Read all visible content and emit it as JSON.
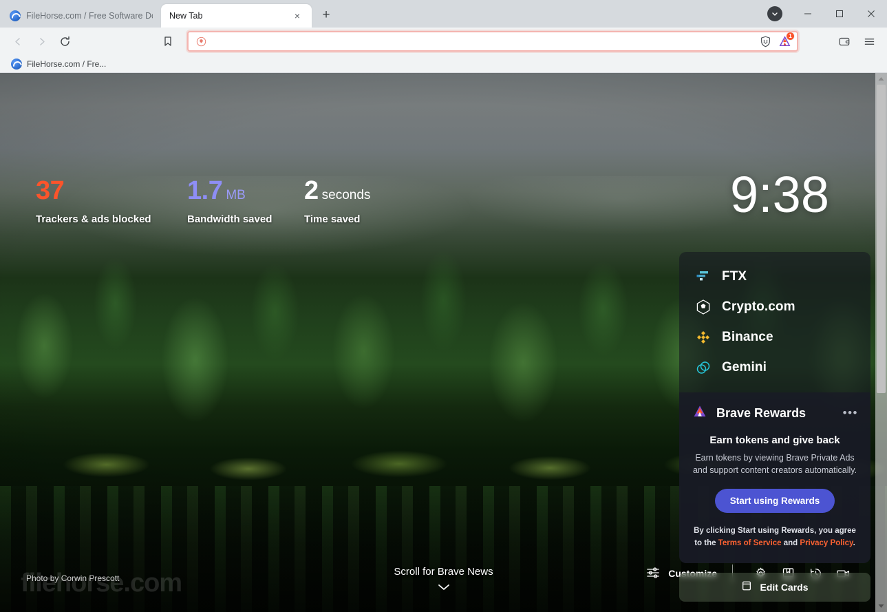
{
  "window": {
    "tabs": [
      {
        "title": "FileHorse.com / Free Software Downlo",
        "active": false
      },
      {
        "title": "New Tab",
        "active": true
      }
    ],
    "new_tab_button": "+",
    "close_tab": "×",
    "controls": {
      "minimize": "minimize-icon",
      "maximize": "maximize-icon",
      "close": "close-icon",
      "tab_search": "chevron-down-icon"
    }
  },
  "toolbar": {
    "back": "back-arrow-icon",
    "forward": "forward-arrow-icon",
    "reload": "reload-icon",
    "bookmark": "bookmark-flag-icon",
    "address_value": "",
    "address_placeholder": "",
    "brave_shields": "brave-shield-icon",
    "brave_rewards": "brave-rewards-triangle-icon",
    "rewards_badge": "1",
    "wallet": "wallet-icon",
    "menu": "hamburger-menu-icon"
  },
  "bookmarks": [
    {
      "label": "FileHorse.com / Fre...",
      "icon": "filehorse-favicon"
    }
  ],
  "ntp": {
    "stats": [
      {
        "value": "37",
        "unit": "",
        "label": "Trackers & ads blocked",
        "color": "#fb542b"
      },
      {
        "value": "1.7",
        "unit": "MB",
        "label": "Bandwidth saved",
        "color": "#8e8ef5"
      },
      {
        "value": "2",
        "unit": "seconds",
        "label": "Time saved",
        "color": "#ffffff"
      }
    ],
    "clock": "9:38",
    "crypto": [
      {
        "name": "FTX",
        "icon": "ftx-icon",
        "color": "#5ac4d9"
      },
      {
        "name": "Crypto.com",
        "icon": "cryptocom-icon",
        "color": "#ffffff"
      },
      {
        "name": "Binance",
        "icon": "binance-icon",
        "color": "#f3ba2f"
      },
      {
        "name": "Gemini",
        "icon": "gemini-icon",
        "color": "#26c6da"
      }
    ],
    "rewards": {
      "title": "Brave Rewards",
      "menu": "•••",
      "headline": "Earn tokens and give back",
      "body": "Earn tokens by viewing Brave Private Ads and support content creators automatically.",
      "cta": "Start using Rewards",
      "tos_prefix": "By clicking Start using Rewards, you agree to the ",
      "tos_link": "Terms of Service",
      "tos_join": " and ",
      "privacy_link": "Privacy Policy",
      "tos_suffix": "."
    },
    "edit_cards": "Edit Cards",
    "photo_credit": "Photo by Corwin Prescott",
    "watermark": "filehorse.com",
    "scroll_news": "Scroll for Brave News",
    "bottom_tools": {
      "customize": "Customize",
      "settings": "gear-icon",
      "bookmarks": "bookmarks-book-icon",
      "history": "history-clock-icon",
      "media": "video-camera-icon"
    }
  },
  "colors": {
    "accent_orange": "#fb542b",
    "accent_purple": "#8e8ef5",
    "rewards_button": "#4c54d2",
    "link_orange": "#fb6232"
  }
}
